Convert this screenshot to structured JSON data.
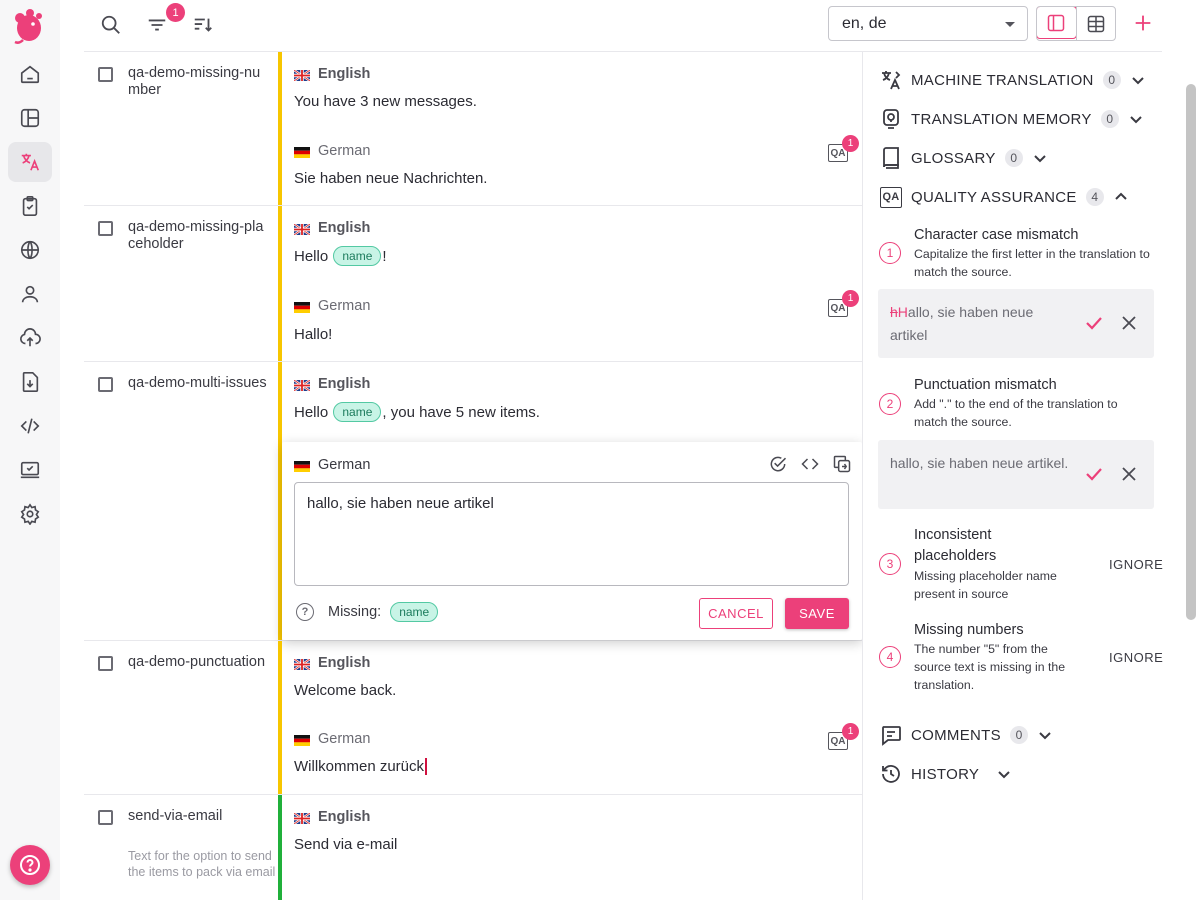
{
  "toolbar": {
    "filter_badge": "1",
    "language_select": "en, de"
  },
  "rows": [
    {
      "key": "qa-demo-missing-number",
      "source_lang": "English",
      "source_text": "You have 3 new messages.",
      "target_lang": "German",
      "target_text": "Sie haben neue Nachrichten.",
      "qa_badge": "1"
    },
    {
      "key": "qa-demo-missing-placeholder",
      "source_lang": "English",
      "source_pre": "Hello ",
      "source_placeholder": "name",
      "source_post": "!",
      "target_lang": "German",
      "target_text": "Hallo!",
      "qa_badge": "1"
    },
    {
      "key": "qa-demo-multi-issues",
      "source_lang": "English",
      "source_pre": "Hello ",
      "source_placeholder": "name",
      "source_post": ", you have 5 new items."
    },
    {
      "key": "qa-demo-punctuation",
      "source_lang": "English",
      "source_text": "Welcome back.",
      "target_lang": "German",
      "target_text": "Willkommen zurück",
      "qa_badge": "1"
    },
    {
      "key": "send-via-email",
      "description": "Text for the option to send the items to pack via email",
      "source_lang": "English",
      "source_text": "Send via e-mail"
    }
  ],
  "editor": {
    "lang": "German",
    "value": "hallo, sie haben neue artikel",
    "missing_label": "Missing:",
    "missing_placeholder": "name",
    "cancel_label": "CANCEL",
    "save_label": "SAVE"
  },
  "panel": {
    "machine_translation": {
      "label": "MACHINE TRANSLATION",
      "count": "0"
    },
    "translation_memory": {
      "label": "TRANSLATION MEMORY",
      "count": "0"
    },
    "glossary": {
      "label": "GLOSSARY",
      "count": "0"
    },
    "quality_assurance": {
      "label": "QUALITY ASSURANCE",
      "count": "4"
    },
    "issues": [
      {
        "num": "1",
        "title": "Character case mismatch",
        "desc": "Capitalize the first letter in the translation to match the source.",
        "suggestion_removed": "h",
        "suggestion_inserted": "H",
        "suggestion_rest": "allo, sie haben neue artikel"
      },
      {
        "num": "2",
        "title": "Punctuation mismatch",
        "desc": "Add \".\" to the end of the translation to match the source.",
        "suggestion": "hallo, sie haben neue artikel."
      },
      {
        "num": "3",
        "title": "Inconsistent placeholders",
        "desc": "Missing placeholder name present in source",
        "action": "IGNORE"
      },
      {
        "num": "4",
        "title": "Missing numbers",
        "desc": "The number \"5\" from the source text is missing in the translation.",
        "action": "IGNORE"
      }
    ],
    "comments": {
      "label": "COMMENTS",
      "count": "0"
    },
    "history": {
      "label": "HISTORY"
    }
  },
  "colors": {
    "accent": "#ec407a",
    "yellow_state": "#f7c600",
    "green_state": "#20b03a",
    "placeholder_bg": "#c8f4e6"
  }
}
